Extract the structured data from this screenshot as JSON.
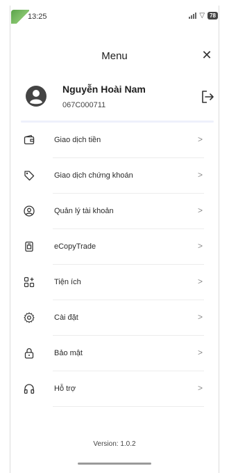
{
  "status_bar": {
    "time": "13:25",
    "battery": "78"
  },
  "header": {
    "title": "Menu",
    "close_icon": "close-icon"
  },
  "profile": {
    "name": "Nguyễn Hoài Nam",
    "account_id": "067C000711",
    "avatar_icon": "account-circle-icon",
    "logout_icon": "logout-icon"
  },
  "menu": {
    "items": [
      {
        "label": "Giao dịch tiền",
        "icon": "wallet-icon"
      },
      {
        "label": "Giao dịch chứng khoán",
        "icon": "tag-icon"
      },
      {
        "label": "Quản lý tài khoản",
        "icon": "user-circle-icon"
      },
      {
        "label": "eCopyTrade",
        "icon": "copy-document-icon"
      },
      {
        "label": "Tiện ích",
        "icon": "apps-grid-icon"
      },
      {
        "label": "Cài đặt",
        "icon": "gear-icon"
      },
      {
        "label": "Bảo mật",
        "icon": "lock-icon"
      },
      {
        "label": "Hỗ trợ",
        "icon": "headphones-icon"
      }
    ],
    "chevron": ">"
  },
  "footer": {
    "version": "Version: 1.0.2"
  },
  "colors": {
    "accent": "#5aa34a",
    "divider": "#ececec",
    "profile_divider": "#eef0fb"
  }
}
